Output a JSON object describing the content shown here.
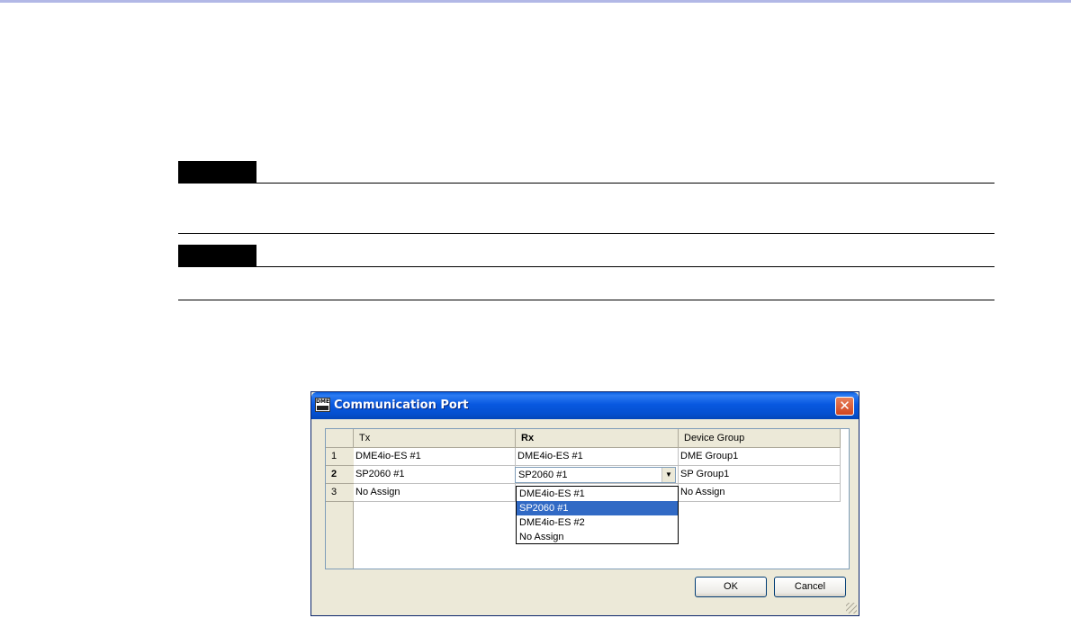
{
  "dialog": {
    "title": "Communication Port",
    "icon_text": "DME",
    "close_glyph": "✕"
  },
  "grid": {
    "columns": [
      "",
      "Tx",
      "Rx",
      "Device Group"
    ],
    "rows": [
      {
        "num": "1",
        "tx": "DME4io-ES #1",
        "rx": "DME4io-ES #1",
        "group": "DME Group1"
      },
      {
        "num": "2",
        "tx": "SP2060 #1",
        "rx": "SP2060 #1",
        "group": "SP Group1"
      },
      {
        "num": "3",
        "tx": "No Assign",
        "rx": "",
        "group": "No Assign"
      }
    ],
    "combo_arrow": "▼",
    "dropdown_options": [
      "DME4io-ES #1",
      "SP2060 #1",
      "DME4io-ES #2",
      "No Assign"
    ],
    "dropdown_selected": "SP2060 #1"
  },
  "buttons": {
    "ok": "OK",
    "cancel": "Cancel"
  },
  "colors": {
    "titlebar": "#0858e0",
    "selection": "#316ac5",
    "close": "#d1451f",
    "note_tab": "#000000"
  }
}
